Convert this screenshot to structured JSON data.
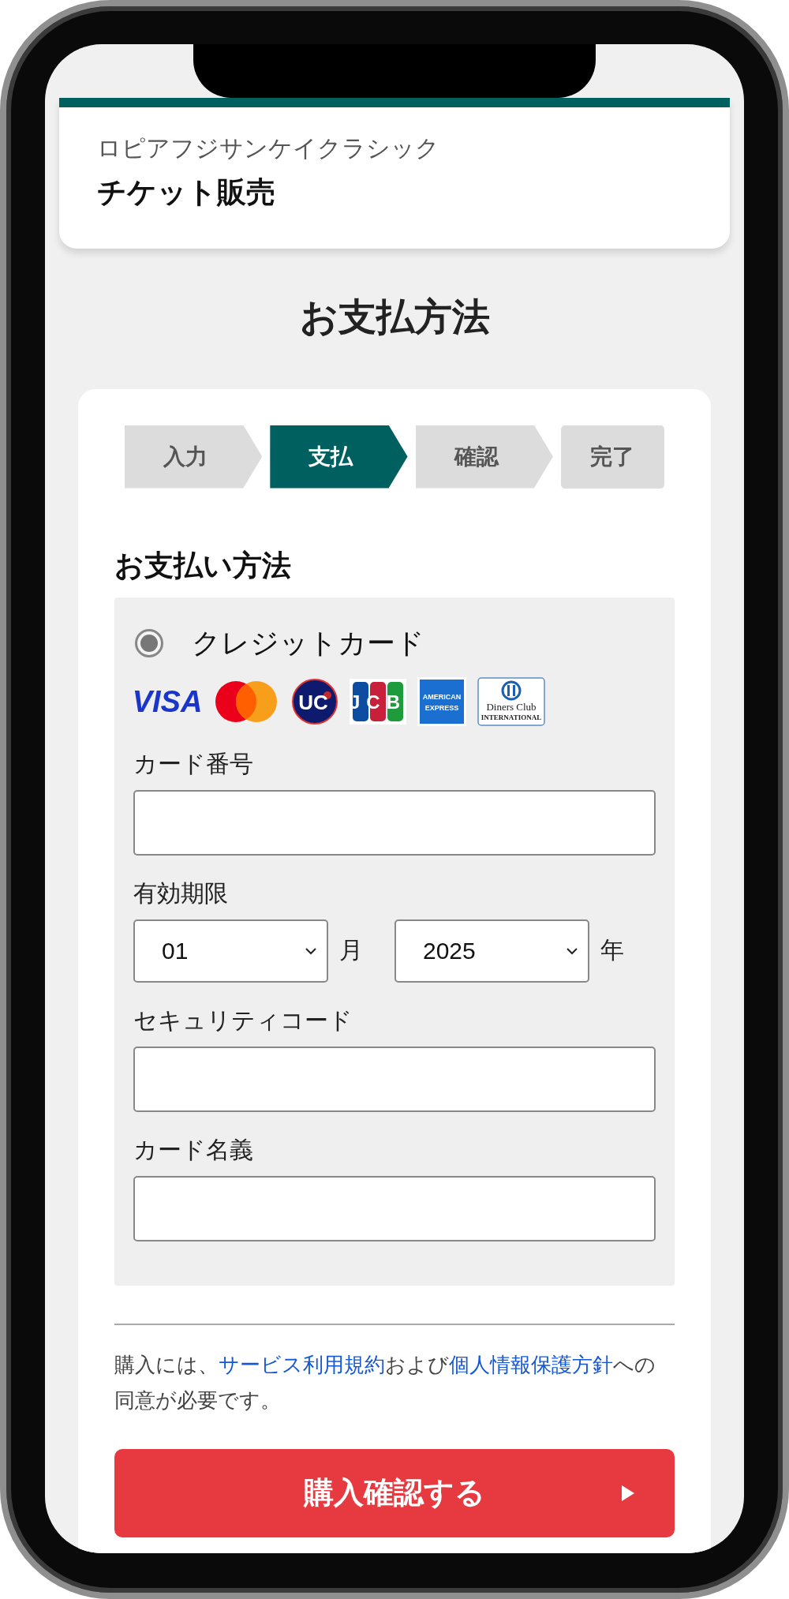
{
  "header": {
    "event": "ロピアフジサンケイクラシック",
    "title": "チケット販売"
  },
  "page_title": "お支払方法",
  "steps": [
    {
      "label": "入力",
      "selected": false
    },
    {
      "label": "支払",
      "selected": true
    },
    {
      "label": "確認",
      "selected": false
    },
    {
      "label": "完了",
      "selected": false
    }
  ],
  "section_title": "お支払い方法",
  "payment_option": {
    "label": "クレジットカード",
    "selected": true
  },
  "card_brands": [
    {
      "kind": "visa",
      "lines": [
        "VISA"
      ]
    },
    {
      "kind": "mastercard"
    },
    {
      "kind": "uc",
      "lines": [
        "UC"
      ]
    },
    {
      "kind": "jcb",
      "lines": [
        "JCB"
      ]
    },
    {
      "kind": "amex",
      "lines": [
        "AMERICAN",
        "EXPRESS"
      ]
    },
    {
      "kind": "diners",
      "lines": [
        "Diners Club",
        "INTERNATIONAL"
      ]
    }
  ],
  "card_number": {
    "label": "カード番号"
  },
  "expiry": {
    "label": "有効期限",
    "month": {
      "value": "01",
      "unit": "月"
    },
    "year": {
      "value": "2025",
      "unit": "年"
    }
  },
  "security_code": {
    "label": "セキュリティコード"
  },
  "card_holder": {
    "label": "カード名義"
  },
  "terms": {
    "before": "購入には、",
    "link_1": "サービス利用規約",
    "middle": "および",
    "link_2": "個人情報保護方針",
    "after": "への同意が必要です。"
  },
  "submit": {
    "label": "購入確認する"
  }
}
